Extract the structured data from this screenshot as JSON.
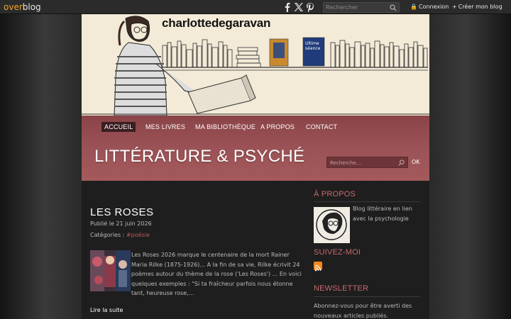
{
  "topbar": {
    "logo_part1": "over",
    "logo_part2": "blog",
    "social_icons": [
      "facebook-icon",
      "x-icon",
      "pinterest-icon"
    ],
    "search_placeholder": "Rechercher",
    "login_label": "Connexion",
    "create_blog_label": "Créer mon blog"
  },
  "banner": {
    "title": "charlottedegaravan"
  },
  "nav": {
    "items": [
      {
        "label": "Accueil",
        "active": true
      },
      {
        "label": "Mes livres",
        "active": false
      },
      {
        "label": "Ma bibliothèque",
        "active": false
      },
      {
        "label": "A propos",
        "active": false
      },
      {
        "label": "Contact",
        "active": false
      }
    ],
    "site_title": "LITTÉRATURE & PSYCHÉ",
    "search_placeholder": "Recherche...",
    "ok_label": "OK"
  },
  "post": {
    "title": "LES ROSES",
    "date": "Publié le 21 juin 2026",
    "categories_label": "Catégories :",
    "category_tag": "#poésie",
    "excerpt": "Les Roses 2026 marque le centenaire de la mort Rainer Maria Rilke (1875-1926)... A la fin de sa vie, Rilke écrivit 24 poèmes autour du thème de la rose ('Les Roses') ... En voici quelques exemples : \"Si ta fraîcheur parfois nous étonne tant, heureuse rose,...",
    "read_more": "Lire la suite"
  },
  "sidebar": {
    "about_heading": "À PROPOS",
    "about_text": "Blog littéraire en lien avec la psychologie",
    "follow_heading": "SUIVEZ-MOI",
    "newsletter_heading": "NEWSLETTER",
    "newsletter_text": "Abonnez-vous pour être averti des nouveaux articles publiés."
  },
  "colors": {
    "accent": "#c86a6d",
    "nav_bg": "#9b5256",
    "logo_orange": "#f5a623",
    "rss": "#f28a1e"
  }
}
